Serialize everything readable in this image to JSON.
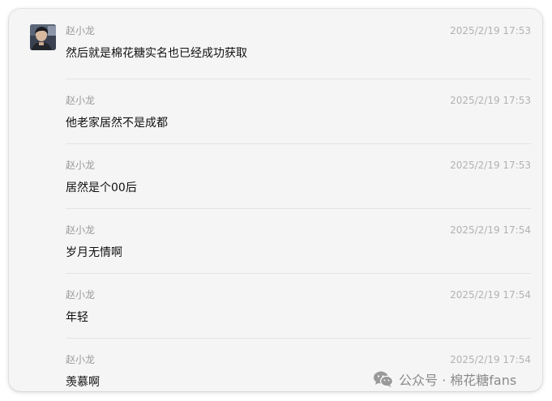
{
  "messages": [
    {
      "sender": "赵小龙",
      "time": "2025/2/19 17:53",
      "text": "然后就是棉花糖实名也已经成功获取"
    },
    {
      "sender": "赵小龙",
      "time": "2025/2/19 17:53",
      "text": "他老家居然不是成都"
    },
    {
      "sender": "赵小龙",
      "time": "2025/2/19 17:53",
      "text": "居然是个00后"
    },
    {
      "sender": "赵小龙",
      "time": "2025/2/19 17:54",
      "text": "岁月无情啊"
    },
    {
      "sender": "赵小龙",
      "time": "2025/2/19 17:54",
      "text": "年轻"
    },
    {
      "sender": "赵小龙",
      "time": "2025/2/19 17:54",
      "text": "羡慕啊"
    }
  ],
  "watermark": {
    "icon": "wechat-icon",
    "text": "公众号 · 棉花糖fans"
  },
  "colors": {
    "panel_background": "#f5f5f5",
    "sender_text": "#9a9a9a",
    "timestamp_text": "#b2b2b2",
    "message_text": "#111111"
  }
}
